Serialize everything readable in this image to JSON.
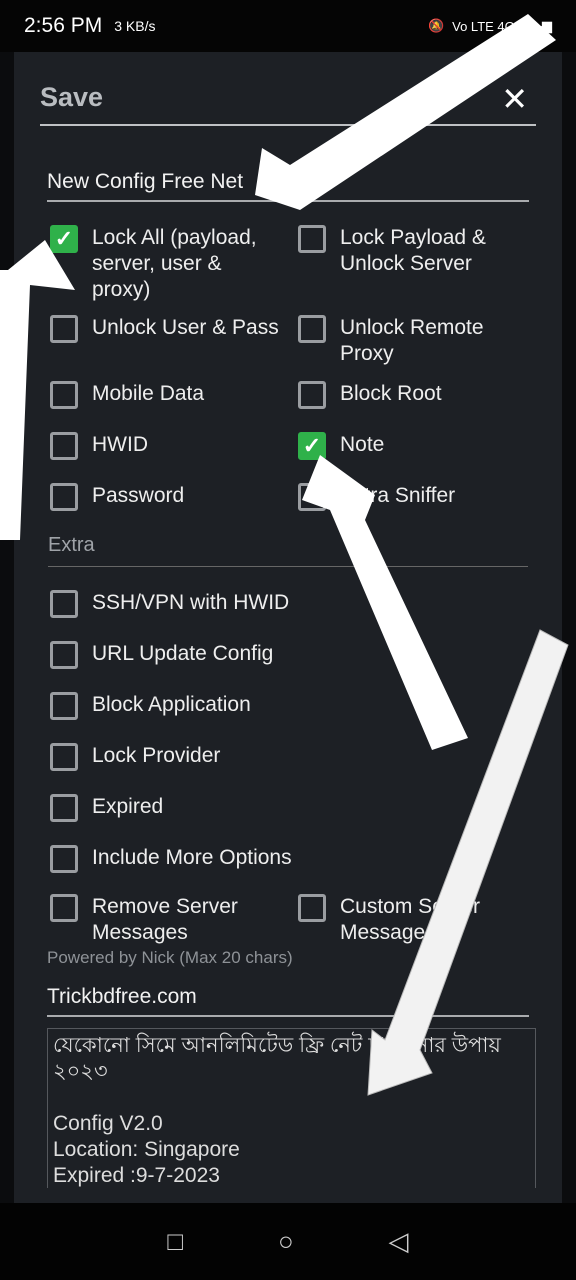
{
  "status_bar": {
    "time": "2:56 PM",
    "speed": "3 KB/s",
    "network": "Vo LTE 4G"
  },
  "dialog": {
    "title": "Save",
    "close_icon": "close-icon",
    "filename_value": "New Config Free Net",
    "lock_options": [
      {
        "label": "Lock All (payload, server, user & proxy)",
        "checked": true
      },
      {
        "label": "Lock Payload & Unlock Server",
        "checked": false
      },
      {
        "label": "Unlock User & Pass",
        "checked": false
      },
      {
        "label": "Unlock Remote Proxy",
        "checked": false
      },
      {
        "label": "Mobile Data",
        "checked": false
      },
      {
        "label": "Block Root",
        "checked": false
      },
      {
        "label": "HWID",
        "checked": false
      },
      {
        "label": "Note",
        "checked": true
      },
      {
        "label": "Password",
        "checked": false
      },
      {
        "label": "Extra Sniffer",
        "checked": false
      }
    ],
    "extra_label": "Extra",
    "extra_options": [
      {
        "label": "SSH/VPN with HWID",
        "checked": false
      },
      {
        "label": "URL Update Config",
        "checked": false
      },
      {
        "label": "Block Application",
        "checked": false
      },
      {
        "label": "Lock Provider",
        "checked": false
      },
      {
        "label": "Expired",
        "checked": false
      },
      {
        "label": "Include More Options",
        "checked": false
      },
      {
        "label": "Remove Server Messages",
        "checked": false
      },
      {
        "label": "Custom Server Messages",
        "checked": false
      }
    ],
    "powered_by_hint": "Powered by Nick (Max 20 chars)",
    "powered_by_value": "Trickbdfree.com",
    "note_text": "যেকোনো সিমে আনলিমিটেড ফ্রি নেট চালানোর উপায় ২০২৩\n\nConfig V2.0\nLocation: Singapore\nExpired :9-7-2023"
  },
  "nav": {
    "recents": "□",
    "home": "○",
    "back": "◁"
  },
  "colors": {
    "checked": "#2fb14a",
    "dialog_bg": "#1d2025"
  }
}
